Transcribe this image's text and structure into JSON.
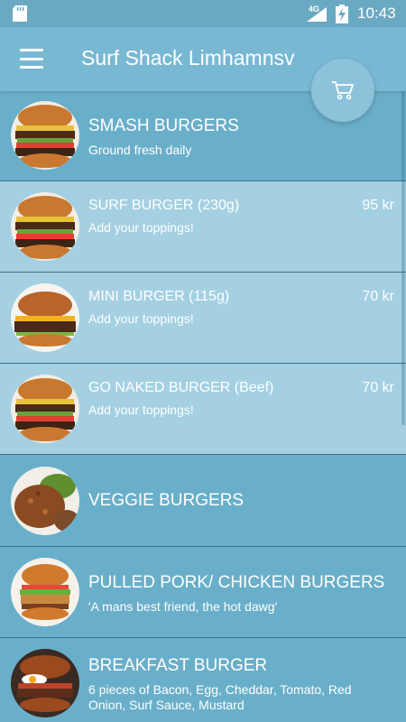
{
  "status_bar": {
    "network": "4G",
    "time": "10:43"
  },
  "app_bar": {
    "title": "Surf Shack Limhamnsv",
    "menu_icon": "hamburger-menu-icon",
    "cart_icon": "shopping-cart-icon"
  },
  "menu": [
    {
      "type": "category",
      "title": "SMASH BURGERS",
      "subtitle": "Ground fresh daily",
      "price": ""
    },
    {
      "type": "item",
      "title": "SURF BURGER (230g)",
      "subtitle": "Add your toppings!",
      "price": "95 kr"
    },
    {
      "type": "item",
      "title": "MINI BURGER (115g)",
      "subtitle": "Add your toppings!",
      "price": "70 kr"
    },
    {
      "type": "item",
      "title": "GO NAKED BURGER (Beef)",
      "subtitle": "Add your toppings!",
      "price": "70 kr"
    },
    {
      "type": "category",
      "title": "VEGGIE BURGERS",
      "subtitle": "",
      "price": ""
    },
    {
      "type": "category",
      "title": "PULLED PORK/ CHICKEN BURGERS",
      "subtitle": "'A mans best friend, the hot dawg'",
      "price": ""
    },
    {
      "type": "category",
      "title": "BREAKFAST BURGER",
      "subtitle": "6 pieces of Bacon, Egg, Cheddar, Tomato, Red Onion, Surf Sauce, Mustard",
      "price": ""
    }
  ],
  "colors": {
    "status_bar": "#6aa9c2",
    "app_bar": "#79b8d3",
    "category_row": "#6aafc9",
    "item_row": "#a4d0e2",
    "divider": "#3c6f8a"
  }
}
